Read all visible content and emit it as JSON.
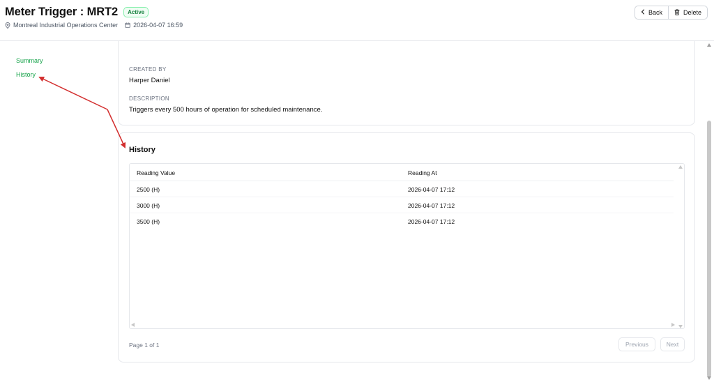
{
  "header": {
    "title": "Meter Trigger : MRT2",
    "status": "Active",
    "location": "Montreal Industrial Operations Center",
    "datetime": "2026-04-07 16:59",
    "back_label": "Back",
    "delete_label": "Delete"
  },
  "sidebar": {
    "items": [
      {
        "label": "Summary"
      },
      {
        "label": "History"
      }
    ]
  },
  "details": {
    "created_by_label": "CREATED BY",
    "created_by_value": "Harper Daniel",
    "description_label": "DESCRIPTION",
    "description_value": "Triggers every 500 hours of operation for scheduled maintenance."
  },
  "history": {
    "title": "History",
    "columns": [
      "Reading Value",
      "Reading At"
    ],
    "rows": [
      {
        "value": "2500 (H)",
        "at": "2026-04-07 17:12"
      },
      {
        "value": "3000 (H)",
        "at": "2026-04-07 17:12"
      },
      {
        "value": "3500 (H)",
        "at": "2026-04-07 17:12"
      }
    ],
    "pagination": {
      "page_text": "Page 1 of 1",
      "previous_label": "Previous",
      "next_label": "Next"
    }
  },
  "colors": {
    "accent": "#16a34a",
    "annotation_arrow": "#d32f2f"
  },
  "icons": [
    "location-pin-icon",
    "calendar-icon",
    "chevron-left-icon",
    "trash-icon"
  ]
}
